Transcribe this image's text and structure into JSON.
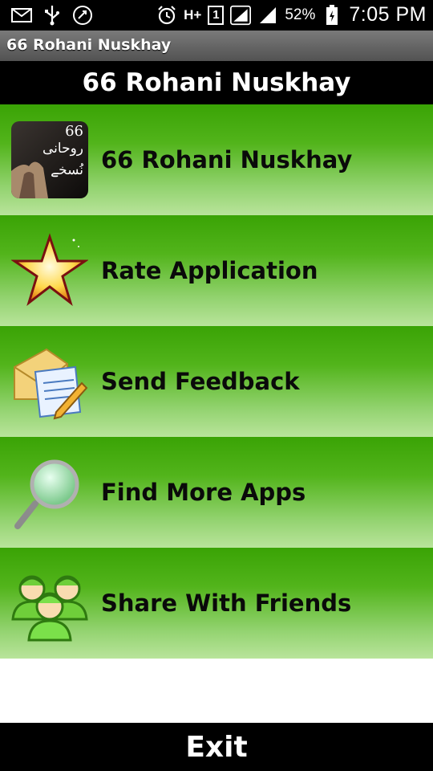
{
  "status_bar": {
    "battery": "52%",
    "time": "7:05 PM",
    "network_type": "H+",
    "sim_slot": "1",
    "icons": [
      "mail-icon",
      "usb-icon",
      "sync-icon",
      "alarm-icon",
      "network-hplus-icon",
      "sim-icon",
      "signal-icon",
      "signal-icon",
      "battery-charging-icon"
    ]
  },
  "app_bar": {
    "title": "66 Rohani Nuskhay"
  },
  "header": {
    "title": "66 Rohani Nuskhay"
  },
  "menu": {
    "items": [
      {
        "label": "66 Rohani Nuskhay",
        "icon": "app-thumbnail-icon",
        "thumb_text": [
          "66",
          "روحانی",
          "نُسخے"
        ]
      },
      {
        "label": "Rate Application",
        "icon": "star-icon"
      },
      {
        "label": "Send Feedback",
        "icon": "mail-document-icon"
      },
      {
        "label": "Find More Apps",
        "icon": "magnifier-icon"
      },
      {
        "label": "Share With Friends",
        "icon": "users-icon"
      }
    ]
  },
  "footer": {
    "exit_label": "Exit"
  },
  "colors": {
    "row_green_top": "#3aa305",
    "row_green_bottom": "#b9e49b",
    "bar_black": "#000000"
  }
}
